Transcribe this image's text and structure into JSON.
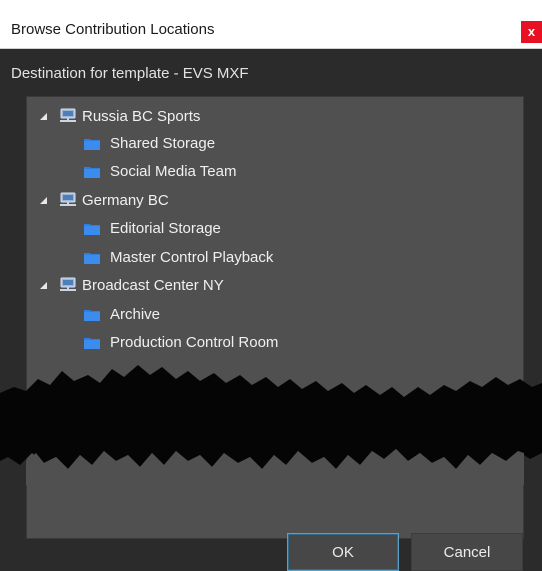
{
  "window": {
    "title": "Browse Contribution Locations",
    "close_label": "x"
  },
  "dialog": {
    "destination_label": "Destination for template - EVS MXF"
  },
  "tree": {
    "servers": [
      {
        "label": "Russia BC Sports",
        "expanded": true,
        "folders": [
          "Shared Storage",
          "Social Media Team"
        ]
      },
      {
        "label": "Germany BC",
        "expanded": true,
        "folders": [
          "Editorial Storage",
          "Master Control Playback"
        ]
      },
      {
        "label": "Broadcast Center NY",
        "expanded": true,
        "folders": [
          "Archive",
          "Production Control Room"
        ]
      }
    ]
  },
  "buttons": {
    "ok_label": "OK",
    "cancel_label": "Cancel"
  },
  "colors": {
    "folder": "#2f7fe0",
    "close_button": "#e81123",
    "ok_focus_border": "#5aa0c8"
  }
}
